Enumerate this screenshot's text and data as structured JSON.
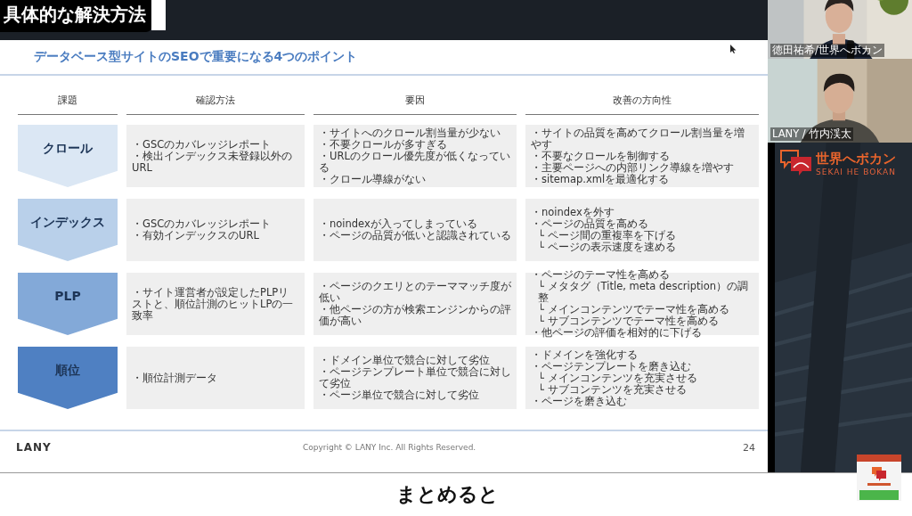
{
  "video_title": "具体的な解決方法",
  "slide": {
    "title": "データベース型サイトのSEOで重要になる4つのポイント",
    "columns": [
      "課題",
      "確認方法",
      "要因",
      "改善の方向性"
    ],
    "rows": [
      {
        "issue": "クロール",
        "color": "#dbe7f4",
        "checks": [
          "・GSCのカバレッジレポート",
          "・検出インデックス未登録以外のURL"
        ],
        "causes": [
          "・サイトへのクロール割当量が少ない",
          "・不要クロールが多すぎる",
          "・URLのクロール優先度が低くなっている",
          "・クロール導線がない"
        ],
        "improvements": [
          {
            "text": "・サイトの品質を高めてクロール割当量を増やす"
          },
          {
            "text": "・不要なクロールを制御する"
          },
          {
            "text": "・主要ページへの内部リンク導線を増やす"
          },
          {
            "text": "・sitemap.xmlを最適化する"
          }
        ]
      },
      {
        "issue": "インデックス",
        "color": "#b9d0ea",
        "checks": [
          "・GSCのカバレッジレポート",
          "・有効インデックスのURL"
        ],
        "causes": [
          "・noindexが入ってしまっている",
          "・ページの品質が低いと認識されている"
        ],
        "improvements": [
          {
            "text": "・noindexを外す"
          },
          {
            "text": "・ページの品質を高める",
            "children": [
              {
                "text": "└ ページ間の重複率を下げる"
              },
              {
                "text": "└ ページの表示速度を速める"
              }
            ]
          }
        ]
      },
      {
        "issue": "PLP",
        "color": "#83a9d8",
        "checks": [
          "・サイト運営者が設定したPLPリストと、順位計測のヒットLPの一致率"
        ],
        "causes": [
          "・ページのクエリとのテーママッチ度が低い",
          "・他ページの方が検索エンジンからの評価が高い"
        ],
        "improvements": [
          {
            "text": "・ページのテーマ性を高める",
            "children": [
              {
                "text": "└ メタタグ（Title, meta description）の調整"
              },
              {
                "text": "└ メインコンテンツでテーマ性を高める"
              },
              {
                "text": "└ サブコンテンツでテーマ性を高める"
              }
            ]
          },
          {
            "text": "・他ページの評価を相対的に下げる"
          }
        ]
      },
      {
        "issue": "順位",
        "color": "#4f80c2",
        "checks": [
          "・順位計測データ"
        ],
        "causes": [
          "・ドメイン単位で競合に対して劣位",
          "・ページテンプレート単位で競合に対して劣位",
          "・ページ単位で競合に対して劣位"
        ],
        "improvements": [
          {
            "text": "・ドメインを強化する"
          },
          {
            "text": "・ページテンプレートを磨き込む",
            "children": [
              {
                "text": "└ メインコンテンツを充実させる"
              },
              {
                "text": "└ サブコンテンツを充実させる"
              }
            ]
          },
          {
            "text": "・ページを磨き込む"
          }
        ]
      }
    ],
    "footer": {
      "brand": "LANY",
      "copyright": "Copyright © LANY Inc. All Rights Reserved.",
      "page": "24"
    }
  },
  "participants": [
    {
      "name": "徳田祐希/世界へボカン"
    },
    {
      "name": "LANY / 竹内渓太"
    }
  ],
  "brand": {
    "name": "世界へボカン",
    "tagline": "SEKAI HE BOKAN"
  },
  "caption": "まとめると"
}
